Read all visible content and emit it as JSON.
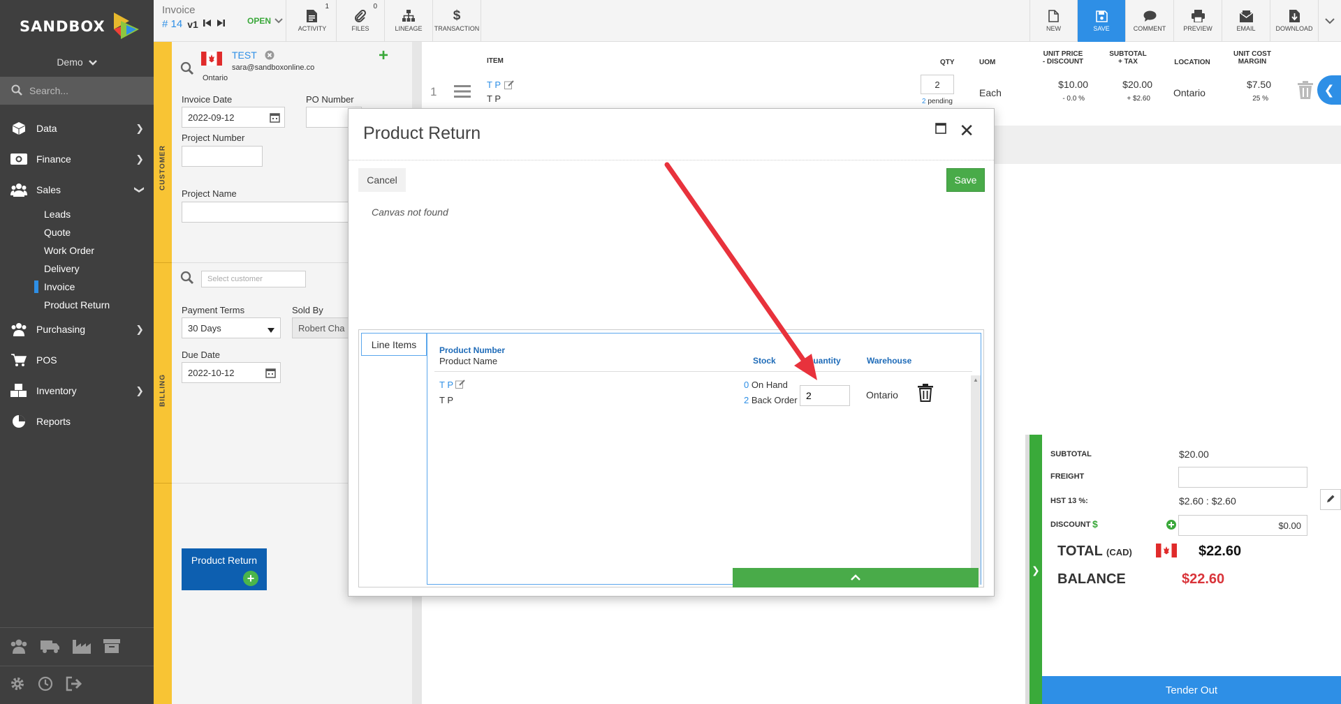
{
  "brand": {
    "name": "SANDBOX",
    "company": "Demo"
  },
  "search": {
    "placeholder": "Search..."
  },
  "sidebar": {
    "items": [
      {
        "label": "Data",
        "icon": "cube-icon"
      },
      {
        "label": "Finance",
        "icon": "cash-icon"
      },
      {
        "label": "Sales",
        "icon": "users-icon"
      },
      {
        "label": "Purchasing",
        "icon": "users-icon"
      },
      {
        "label": "POS",
        "icon": "cart-icon"
      },
      {
        "label": "Inventory",
        "icon": "boxes-icon"
      },
      {
        "label": "Reports",
        "icon": "pie-chart-icon"
      }
    ],
    "sales_sub": [
      "Leads",
      "Quote",
      "Work Order",
      "Delivery",
      "Invoice",
      "Product Return"
    ],
    "active_sub": "Invoice"
  },
  "toolbar": {
    "doc_type": "Invoice",
    "doc_number": "# 14",
    "version": "v1",
    "status": "OPEN",
    "activity": {
      "label": "ACTIVITY",
      "count": "1"
    },
    "files": {
      "label": "FILES",
      "count": "0"
    },
    "lineage": "LINEAGE",
    "transaction": "TRANSACTION",
    "new": "NEW",
    "save": "SAVE",
    "comment": "COMMENT",
    "preview": "PREVIEW",
    "email": "EMAIL",
    "download": "DOWNLOAD"
  },
  "customer": {
    "section_label": "CUSTOMER",
    "name": "TEST",
    "email": "sara@sandboxonline.co",
    "region": "Ontario",
    "invoice_date_label": "Invoice Date",
    "invoice_date": "2022-09-12",
    "po_label": "PO Number",
    "project_number_label": "Project Number",
    "project_name_label": "Project Name"
  },
  "billing": {
    "section_label": "BILLING",
    "select_placeholder": "Select customer",
    "payment_terms_label": "Payment Terms",
    "payment_terms": "30 Days",
    "sold_by_label": "Sold By",
    "sold_by": "Robert Cha",
    "due_date_label": "Due Date",
    "due_date": "2022-10-12"
  },
  "product_return_button": "Product Return",
  "line_table": {
    "headers": {
      "item": "ITEM",
      "qty": "QTY",
      "uom": "UOM",
      "unit_price": "UNIT PRICE",
      "unit_price_sub": "- DISCOUNT",
      "subtotal": "SUBTOTAL",
      "subtotal_sub": "+ TAX",
      "location": "LOCATION",
      "unit_cost": "UNIT COST",
      "unit_cost_sub": "MARGIN"
    },
    "row": {
      "index": "1",
      "code": "T P",
      "name": "T P",
      "qty": "2",
      "pending_count": "2",
      "pending_label": "pending",
      "uom": "Each",
      "price": "$10.00",
      "discount": "- 0.0 %",
      "subtotal": "$20.00",
      "tax": "+ $2.60",
      "location": "Ontario",
      "unit_cost": "$7.50",
      "margin": "25 %"
    }
  },
  "totals": {
    "subtotal_label": "SUBTOTAL",
    "subtotal": "$20.00",
    "freight_label": "FREIGHT",
    "hst_label": "HST 13 %:",
    "hst": "$2.60 : $2.60",
    "discount_label": "DISCOUNT",
    "discount_currency": "$",
    "discount": "$0.00",
    "total_label": "TOTAL",
    "total_currency": "(CAD)",
    "total": "$22.60",
    "balance_label": "BALANCE",
    "balance": "$22.60",
    "tender_label": "Tender Out"
  },
  "modal": {
    "title": "Product Return",
    "cancel": "Cancel",
    "save": "Save",
    "canvas_message": "Canvas not found",
    "tab": "Line Items",
    "headers": {
      "product_number": "Product Number",
      "product_name": "Product Name",
      "stock": "Stock",
      "quantity": "Quantity",
      "warehouse": "Warehouse"
    },
    "row": {
      "code": "T P",
      "name": "T P",
      "on_hand_count": "0",
      "on_hand_label": "On Hand",
      "back_order_count": "2",
      "back_order_label": "Back Order",
      "quantity": "2",
      "warehouse": "Ontario"
    }
  },
  "colors": {
    "accent": "#2e8fe6",
    "ribbon": "#f8c434",
    "success": "#49ab49",
    "balance": "#d9343a",
    "sidebar": "#3f3f3f",
    "annotation_arrow": "#e8323c"
  }
}
